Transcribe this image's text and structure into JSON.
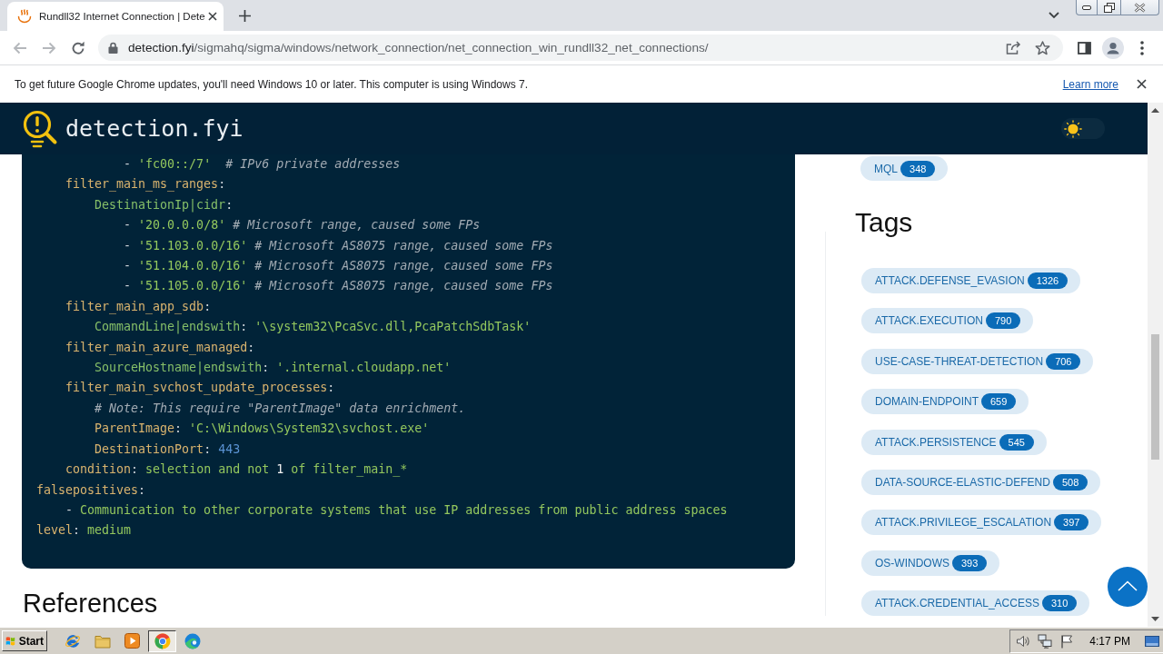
{
  "browser": {
    "tabs": [
      {
        "title": "Rundll32 Internet Connection | Dete",
        "selected": true
      }
    ],
    "back": {
      "disabled": true
    },
    "forward": {
      "disabled": true
    },
    "address": {
      "host": "detection.fyi",
      "path": "/sigmahq/sigma/windows/network_connection/net_connection_win_rundll32_net_connections/"
    },
    "infobar": {
      "message": "To get future Google Chrome updates, you'll need Windows 10 or later. This computer is using Windows 7.",
      "link": "Learn more"
    }
  },
  "site": {
    "name": "detection.fyi",
    "dark_mode": false
  },
  "rule_yaml": {
    "lines": [
      {
        "tokens": [
          {
            "kind": "punct",
            "text": "            - "
          },
          {
            "kind": "string",
            "text": "'fc00::/7'"
          },
          {
            "kind": "comment",
            "text": "  # IPv6 private addresses"
          }
        ]
      },
      {
        "tokens": [
          {
            "kind": "key",
            "text": "    filter_main_ms_ranges"
          },
          {
            "kind": "punct",
            "text": ":"
          }
        ]
      },
      {
        "tokens": [
          {
            "kind": "name",
            "text": "        DestinationIp|cidr"
          },
          {
            "kind": "punct",
            "text": ":"
          }
        ]
      },
      {
        "tokens": [
          {
            "kind": "punct",
            "text": "            - "
          },
          {
            "kind": "string",
            "text": "'20.0.0.0/8'"
          },
          {
            "kind": "comment",
            "text": " # Microsoft range, caused some FPs"
          }
        ]
      },
      {
        "tokens": [
          {
            "kind": "punct",
            "text": "            - "
          },
          {
            "kind": "string",
            "text": "'51.103.0.0/16'"
          },
          {
            "kind": "comment",
            "text": " # Microsoft AS8075 range, caused some FPs"
          }
        ]
      },
      {
        "tokens": [
          {
            "kind": "punct",
            "text": "            - "
          },
          {
            "kind": "string",
            "text": "'51.104.0.0/16'"
          },
          {
            "kind": "comment",
            "text": " # Microsoft AS8075 range, caused some FPs"
          }
        ]
      },
      {
        "tokens": [
          {
            "kind": "punct",
            "text": "            - "
          },
          {
            "kind": "string",
            "text": "'51.105.0.0/16'"
          },
          {
            "kind": "comment",
            "text": " # Microsoft AS8075 range, caused some FPs"
          }
        ]
      },
      {
        "tokens": [
          {
            "kind": "key",
            "text": "    filter_main_app_sdb"
          },
          {
            "kind": "punct",
            "text": ":"
          }
        ]
      },
      {
        "tokens": [
          {
            "kind": "name",
            "text": "        CommandLine|endswith"
          },
          {
            "kind": "punct",
            "text": ": "
          },
          {
            "kind": "string",
            "text": "'\\system32\\PcaSvc.dll,PcaPatchSdbTask'"
          }
        ]
      },
      {
        "tokens": [
          {
            "kind": "key",
            "text": "    filter_main_azure_managed"
          },
          {
            "kind": "punct",
            "text": ":"
          }
        ]
      },
      {
        "tokens": [
          {
            "kind": "name",
            "text": "        SourceHostname|endswith"
          },
          {
            "kind": "punct",
            "text": ": "
          },
          {
            "kind": "string",
            "text": "'.internal.cloudapp.net'"
          }
        ]
      },
      {
        "tokens": [
          {
            "kind": "key",
            "text": "    filter_main_svchost_update_processes"
          },
          {
            "kind": "punct",
            "text": ":"
          }
        ]
      },
      {
        "tokens": [
          {
            "kind": "comment",
            "text": "        # Note: This require \"ParentImage\" data enrichment."
          }
        ]
      },
      {
        "tokens": [
          {
            "kind": "key",
            "text": "        ParentImage"
          },
          {
            "kind": "punct",
            "text": ": "
          },
          {
            "kind": "string",
            "text": "'C:\\Windows\\System32\\svchost.exe'"
          }
        ]
      },
      {
        "tokens": [
          {
            "kind": "key",
            "text": "        DestinationPort"
          },
          {
            "kind": "punct",
            "text": ": "
          },
          {
            "kind": "number",
            "text": "443"
          }
        ]
      },
      {
        "tokens": [
          {
            "kind": "key",
            "text": "    condition"
          },
          {
            "kind": "punct",
            "text": ": "
          },
          {
            "kind": "string",
            "text": "selection and not "
          },
          {
            "kind": "plain",
            "text": "1"
          },
          {
            "kind": "string",
            "text": " of filter_main_*"
          }
        ]
      },
      {
        "tokens": [
          {
            "kind": "key",
            "text": "falsepositives"
          },
          {
            "kind": "punct",
            "text": ":"
          }
        ]
      },
      {
        "tokens": [
          {
            "kind": "punct",
            "text": "    - "
          },
          {
            "kind": "string",
            "text": "Communication to other corporate systems that use IP addresses from public address spaces"
          }
        ]
      },
      {
        "tokens": [
          {
            "kind": "key",
            "text": "level"
          },
          {
            "kind": "punct",
            "text": ": "
          },
          {
            "kind": "string",
            "text": "medium"
          }
        ]
      }
    ]
  },
  "references": {
    "heading": "References"
  },
  "sidebar": {
    "top_chips": [
      {
        "label": "MQL",
        "count": "348"
      }
    ],
    "tags_heading": "Tags",
    "tags": [
      {
        "label": "ATTACK.DEFENSE_EVASION",
        "count": "1326"
      },
      {
        "label": "ATTACK.EXECUTION",
        "count": "790"
      },
      {
        "label": "USE-CASE-THREAT-DETECTION",
        "count": "706"
      },
      {
        "label": "DOMAIN-ENDPOINT",
        "count": "659"
      },
      {
        "label": "ATTACK.PERSISTENCE",
        "count": "545"
      },
      {
        "label": "DATA-SOURCE-ELASTIC-DEFEND",
        "count": "508"
      },
      {
        "label": "ATTACK.PRIVILEGE_ESCALATION",
        "count": "397"
      },
      {
        "label": "OS-WINDOWS",
        "count": "393"
      },
      {
        "label": "ATTACK.CREDENTIAL_ACCESS",
        "count": "310"
      }
    ]
  },
  "taskbar": {
    "start": "Start",
    "apps": [
      {
        "selected": false
      },
      {
        "selected": false
      },
      {
        "selected": false
      },
      {
        "selected": true
      },
      {
        "selected": false
      }
    ],
    "clock": "4:17 PM"
  }
}
